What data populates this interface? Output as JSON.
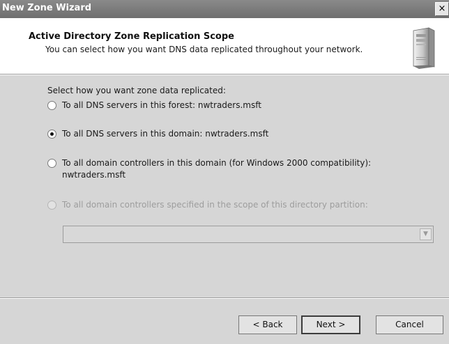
{
  "window": {
    "title": "New Zone Wizard",
    "close_label": "×"
  },
  "header": {
    "title": "Active Directory Zone Replication Scope",
    "subtitle": "You can select how you want DNS data replicated throughout your network.",
    "icon": "server-tower-icon"
  },
  "body": {
    "prompt": "Select how you want zone data replicated:",
    "options": [
      {
        "label": "To all DNS servers in this forest: nwtraders.msft",
        "checked": false,
        "enabled": true
      },
      {
        "label": "To all DNS servers in this domain: nwtraders.msft",
        "checked": true,
        "enabled": true
      },
      {
        "label": "To all domain controllers in this domain (for Windows 2000 compatibility):",
        "label_line2": "nwtraders.msft",
        "checked": false,
        "enabled": true
      },
      {
        "label": "To all domain controllers specified in the scope of this directory partition:",
        "checked": false,
        "enabled": false
      }
    ],
    "partition_combo": {
      "value": "",
      "enabled": false,
      "arrow": "▼"
    }
  },
  "footer": {
    "back_label": "< Back",
    "next_label": "Next >",
    "cancel_label": "Cancel"
  }
}
